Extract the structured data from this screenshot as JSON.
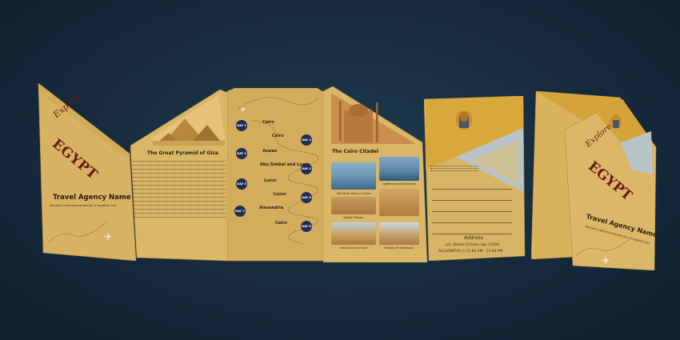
{
  "left_card": {
    "explore": "Explore",
    "title": "EGYPT",
    "agency": "Travel Agency Name",
    "tagline": "Ancient entertainments for a modern era"
  },
  "pyramid_panel": {
    "heading": "The Great Pyramid of Giza"
  },
  "itinerary": {
    "days": [
      {
        "badge": "DAY 1",
        "city": "Cairo"
      },
      {
        "badge": "DAY 2",
        "city": "Cairo"
      },
      {
        "badge": "DAY 3",
        "city": "Aswan"
      },
      {
        "badge": "DAY 4",
        "city": "Abu Simbel and Luxor"
      },
      {
        "badge": "DAY 5",
        "city": "Luxor"
      },
      {
        "badge": "DAY 6",
        "city": "Luxor"
      },
      {
        "badge": "DAY 7",
        "city": "Alexandria"
      },
      {
        "badge": "DAY 8",
        "city": "Cairo"
      }
    ]
  },
  "citadel_panel": {
    "heading": "The Cairo Citadel",
    "captions": [
      "Nile River Felucca Cruise",
      "Lighthouse of Alexandria",
      "Karnak Temple",
      "Great Sphinx of Giza",
      "Temple of Hatshepsut"
    ]
  },
  "contact_panel": {
    "address_label": "Address",
    "address": "xyz, Street 123near abc 23456",
    "phone_hours": "5412698703  ◷ 11:00 AM - 11:00 PM"
  },
  "right_card": {
    "explore": "Explore",
    "title": "EGYPT",
    "agency": "Travel Agency Name",
    "tagline": "Ancient entertainments for a modern era"
  },
  "colors": {
    "background": "#16293a",
    "paper": "#d8b566",
    "title_red": "#6b1a12",
    "badge_navy": "#1e2f55"
  }
}
